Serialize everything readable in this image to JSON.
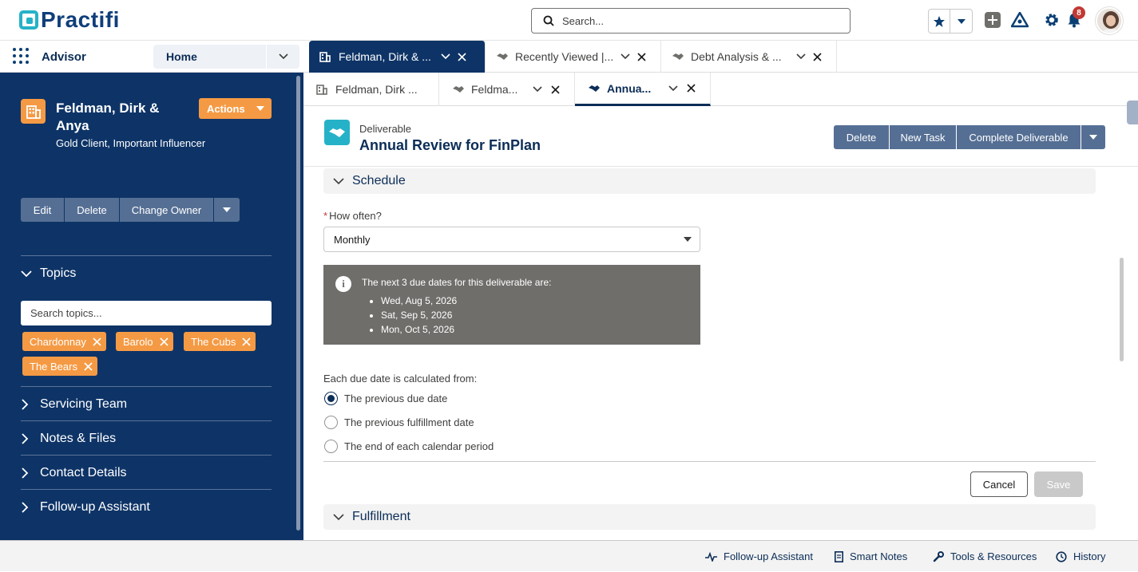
{
  "header": {
    "logo_text": "Practifi",
    "search_placeholder": "Search...",
    "notification_count": "8"
  },
  "nav": {
    "app_name": "Advisor",
    "home_label": "Home",
    "workspace_tabs": [
      {
        "label": "Feldman, Dirk & ...",
        "icon": "building-icon",
        "active": true
      },
      {
        "label": "Recently Viewed |...",
        "icon": "handshake-icon",
        "active": false
      },
      {
        "label": "Debt Analysis & ...",
        "icon": "handshake-icon",
        "active": false
      }
    ]
  },
  "account": {
    "name": "Feldman, Dirk & Anya",
    "subtitle": "Gold Client, Important Influencer",
    "actions_label": "Actions",
    "buttons": {
      "edit": "Edit",
      "delete": "Delete",
      "change_owner": "Change Owner"
    },
    "topics_label": "Topics",
    "topics_search_placeholder": "Search topics...",
    "topics": [
      "Chardonnay",
      "Barolo",
      "The Cubs",
      "The Bears"
    ],
    "sections": [
      "Servicing Team",
      "Notes & Files",
      "Contact Details",
      "Follow-up Assistant"
    ]
  },
  "subtabs": [
    {
      "label": "Feldman, Dirk ...",
      "icon": "building-icon",
      "active": false
    },
    {
      "label": "Feldma...",
      "icon": "handshake-icon",
      "active": false
    },
    {
      "label": "Annua...",
      "icon": "handshake-icon",
      "active": true
    }
  ],
  "record": {
    "type": "Deliverable",
    "title": "Annual Review for FinPlan",
    "buttons": {
      "delete": "Delete",
      "new_task": "New Task",
      "complete": "Complete Deliverable"
    }
  },
  "schedule": {
    "section_label": "Schedule",
    "how_often_label": "How often?",
    "how_often_value": "Monthly",
    "info_heading": "The next 3 due dates for this deliverable are:",
    "due_dates": [
      "Wed, Aug 5, 2026",
      "Sat, Sep 5, 2026",
      "Mon, Oct 5, 2026"
    ],
    "calc_label": "Each due date is calculated from:",
    "calc_options": [
      "The previous due date",
      "The previous fulfillment date",
      "The end of each calendar period"
    ],
    "calc_selected": 0,
    "cancel_label": "Cancel",
    "save_label": "Save"
  },
  "fulfillment": {
    "section_label": "Fulfillment"
  },
  "footer": {
    "items": [
      {
        "label": "Follow-up Assistant",
        "icon": "pulse-icon"
      },
      {
        "label": "Smart Notes",
        "icon": "document-icon"
      },
      {
        "label": "Tools & Resources",
        "icon": "wrench-icon"
      },
      {
        "label": "History",
        "icon": "clock-icon"
      }
    ]
  },
  "colors": {
    "navy": "#0e3467",
    "accent_orange": "#f59a44",
    "teal": "#25b2c8",
    "button_slate": "#556f94"
  }
}
